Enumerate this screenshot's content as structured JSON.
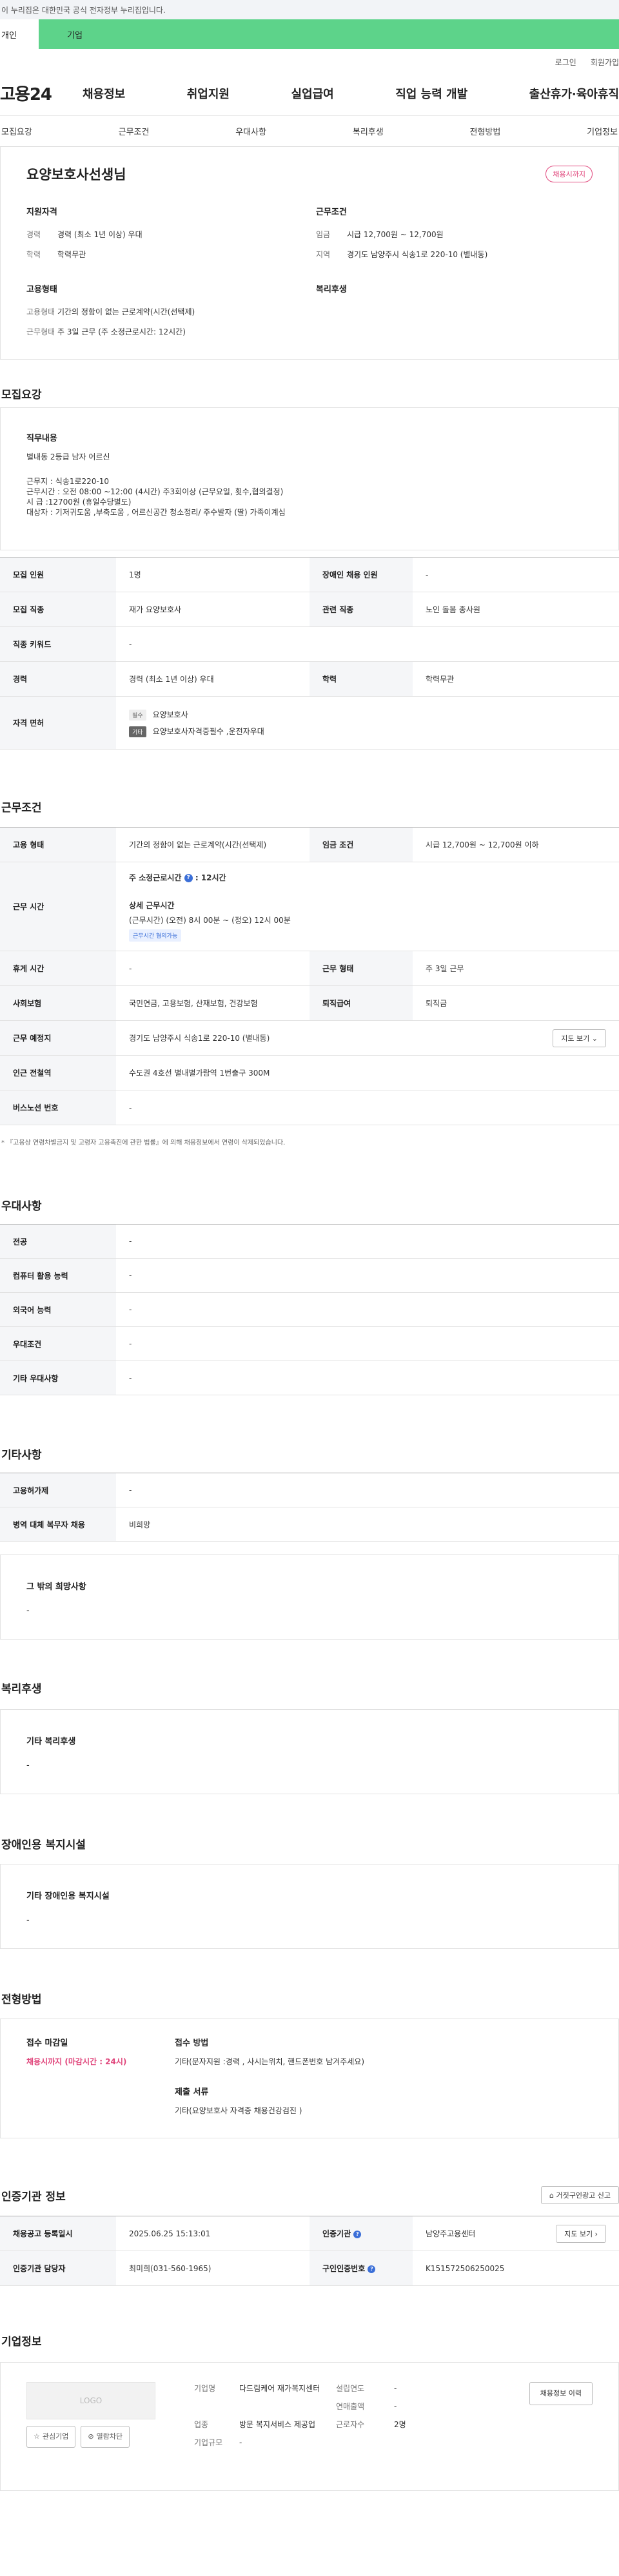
{
  "gov_banner": "이 누리집은 대한민국 공식 전자정부 누리집입니다.",
  "tabs": {
    "a": "개인",
    "b": "기업"
  },
  "util": {
    "login": "로그인",
    "join": "회원가입"
  },
  "logo": "고용24",
  "gnb": [
    "채용정보",
    "취업지원",
    "실업급여",
    "직업 능력 개발",
    "출산휴가·육아휴직"
  ],
  "anchor_nav": [
    "모집요강",
    "근무조건",
    "우대사항",
    "복리후생",
    "전형방법",
    "기업정보"
  ],
  "summary": {
    "title": "요양보호사선생님",
    "badge": "채용시까지",
    "groups": [
      {
        "title": "지원자격",
        "rows": [
          {
            "k": "경력",
            "v": "경력 (최소 1년 이상) 우대"
          },
          {
            "k": "학력",
            "v": "학력무관"
          }
        ]
      },
      {
        "title": "근무조건",
        "rows": [
          {
            "k": "임금",
            "v": "시급 12,700원 ~ 12,700원"
          },
          {
            "k": "지역",
            "v": "경기도 남양주시 식송1로 220-10 (별내동)"
          }
        ]
      },
      {
        "title": "고용형태",
        "rows": [
          {
            "k": "고용형태",
            "v": "기간의 정함이 없는 근로계약(시간(선택제)"
          },
          {
            "k": "근무형태",
            "v": "주 3일 근무 (주 소정근로시간: 12시간)"
          }
        ]
      },
      {
        "title": "복리후생",
        "rows": []
      }
    ]
  },
  "recruit": {
    "title": "모집요강",
    "duty_title": "직무내용",
    "duty_lines": [
      "별내동 2등급 남자 어르신",
      "",
      "근무지 : 식송1로220-10",
      "근무시간 : 오전 08:00 ~12:00 (4시간) 주3회이상 (근무요일, 횟수,협의결정)",
      "시 급 :12700원 (휴일수당별도)",
      "대상자 : 기저귀도움 ,부축도움 , 어르신공간 청소정리/ 주수발자 (딸) 가족이계심"
    ],
    "rows": {
      "count_label": "모집 인원",
      "count": "1명",
      "disabled_label": "장애인 채용 인원",
      "disabled": "-",
      "job_label": "모집 직종",
      "job": "재가 요양보호사",
      "related_label": "관련 직종",
      "related": "노인 돌봄 종사원",
      "keyword_label": "직종 키워드",
      "keyword": "-",
      "career_label": "경력",
      "career": "경력 (최소 1년 이상) 우대",
      "edu_label": "학력",
      "edu": "학력무관",
      "license_label": "자격 면허",
      "license1_tag": "필수",
      "license1": "요양보호사",
      "license2_tag": "기타",
      "license2": "요양보호사자격증필수 ,운전자우대"
    }
  },
  "conditions": {
    "title": "근무조건",
    "type_label": "고용 형태",
    "type": "기간의 정함이 없는 근로계약(시간(선택제)",
    "wage_label": "임금 조건",
    "wage": "시급 12,700원 ~ 12,700원 이하",
    "hours_label": "근무 시간",
    "hours_weekly_label": "주 소정근로시간",
    "hours_weekly": "12시간",
    "hours_detail_label": "상세 근무시간",
    "hours_detail": "(근무시간) (오전) 8시 00분 ~ (정오) 12시 00분",
    "hours_chip": "근무시간 협의가능",
    "break_label": "휴게 시간",
    "break": "-",
    "worktype_label": "근무 형태",
    "worktype": "주 3일 근무",
    "insurance_label": "사회보험",
    "insurance": "국민연금, 고용보험, 산재보험, 건강보험",
    "retire_label": "퇴직급여",
    "retire": "퇴직금",
    "place_label": "근무 예정지",
    "place": "경기도 남양주시 식송1로 220-10 (별내동)",
    "map_btn": "지도 보기",
    "subway_label": "인근 전철역",
    "subway": "수도권 4호선 별내별가람역 1번출구 300M",
    "bus_label": "버스노선 번호",
    "bus": "-",
    "note": "* 『고용상 연령차별금지 및 고령자 고용촉진에 관한 법률』에 의해 채용정보에서 연령이 삭제되었습니다."
  },
  "prefer": {
    "title": "우대사항",
    "rows": [
      {
        "k": "전공",
        "v": "-"
      },
      {
        "k": "컴퓨터 활용 능력",
        "v": "-"
      },
      {
        "k": "외국어 능력",
        "v": "-"
      },
      {
        "k": "우대조건",
        "v": "-"
      },
      {
        "k": "기타 우대사항",
        "v": "-"
      }
    ]
  },
  "etc": {
    "title": "기타사항",
    "rows": [
      {
        "k": "고용허가제",
        "v": "-"
      },
      {
        "k": "병역 대체 복무자 채용",
        "v": "비희망"
      }
    ],
    "box_title": "그 밖의 희망사항",
    "box_value": "-"
  },
  "welfare": {
    "title": "복리후생",
    "box_title": "기타 복리후생",
    "box_value": "-"
  },
  "disabled_fac": {
    "title": "장애인용 복지시설",
    "box_title": "기타 장애인용 복지시설",
    "box_value": "-"
  },
  "selection": {
    "title": "전형방법",
    "deadline_label": "접수 마감일",
    "deadline": "채용시까지 (마감시간 : 24시)",
    "method_label": "접수 방법",
    "method": "기타(문자지원 :경력 , 사시는위치, 핸드폰번호 남겨주세요)",
    "docs_label": "제출 서류",
    "docs": "기타(요양보호사 자격증 채용건강검진 )"
  },
  "cert": {
    "title": "인증기관 정보",
    "report_btn": "거짓구인광고 신고",
    "reg_label": "채용공고 등록일시",
    "reg": "2025.06.25 15:13:01",
    "agency_label": "인증기관",
    "agency": "남양주고용센터",
    "map_btn": "지도 보기",
    "manager_label": "인증기관 담당자",
    "manager": "최미희(031-560-1965)",
    "no_label": "구인인증번호",
    "no": "K151572506250025"
  },
  "company": {
    "title": "기업정보",
    "logo": "LOGO",
    "fav_btn": "관심기업",
    "block_btn": "열람차단",
    "info_btn": "채용정보 이력",
    "name_label": "기업명",
    "name": "다드림케어 재가복지센터",
    "year_label": "설립연도",
    "year": "-",
    "sales_label": "연매출액",
    "sales": "-",
    "industry_label": "업종",
    "industry": "방문 복지서비스 제공업",
    "employees_label": "근로자수",
    "employees": "2명",
    "size_label": "기업규모",
    "size": "-"
  }
}
